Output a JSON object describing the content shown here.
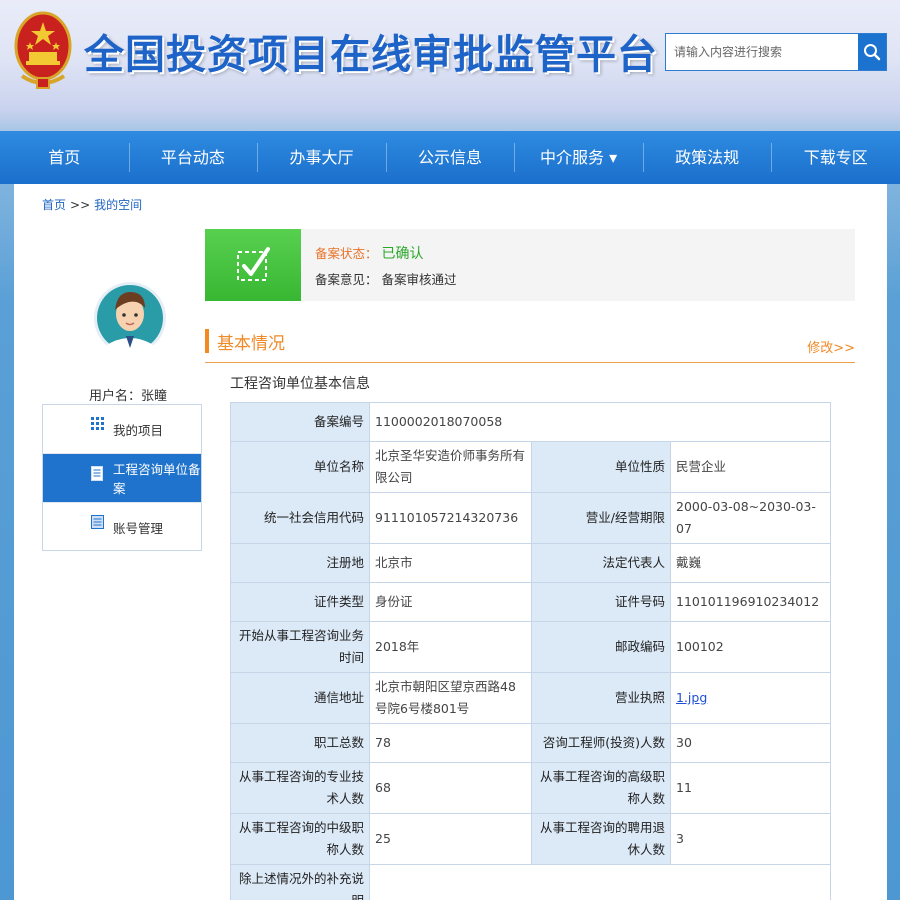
{
  "header": {
    "title": "全国投资项目在线审批监管平台",
    "search_placeholder": "请输入内容进行搜索"
  },
  "nav": {
    "items": [
      "首页",
      "平台动态",
      "办事大厅",
      "公示信息",
      "中介服务 ▾",
      "政策法规",
      "下载专区"
    ]
  },
  "breadcrumb": {
    "home": "首页",
    "sep": ">>",
    "current": "我的空间"
  },
  "user": {
    "label": "用户名：张瞳"
  },
  "side_menu": {
    "items": [
      {
        "label": "我的项目",
        "icon": "grid-icon"
      },
      {
        "label": "工程咨询单位备案",
        "icon": "document-icon",
        "active": true
      },
      {
        "label": "账号管理",
        "icon": "account-icon"
      }
    ]
  },
  "status": {
    "state_label": "备案状态：",
    "state_value": "已确认",
    "opinion_label": "备案意见：",
    "opinion_value": "备案审核通过"
  },
  "section": {
    "title": "基本情况",
    "edit": "修改>>"
  },
  "subtitle": "工程咨询单位基本信息",
  "table": {
    "filing_no_label": "备案编号",
    "filing_no": "1100002018070058",
    "unit_name_label": "单位名称",
    "unit_name": "北京圣华安造价师事务所有限公司",
    "nature_label": "单位性质",
    "nature": "民营企业",
    "credit_code_label": "统一社会信用代码",
    "credit_code": "911101057214320736",
    "period_label": "营业/经营期限",
    "period": "2000-03-08~2030-03-07",
    "reg_place_label": "注册地",
    "reg_place": "北京市",
    "legal_rep_label": "法定代表人",
    "legal_rep": "戴巍",
    "id_type_label": "证件类型",
    "id_type": "身份证",
    "id_no_label": "证件号码",
    "id_no": "110101196910234012",
    "start_year_label": "开始从事工程咨询业务时间",
    "start_year": "2018年",
    "postcode_label": "邮政编码",
    "postcode": "100102",
    "address_label": "通信地址",
    "address": "北京市朝阳区望京西路48号院6号楼801号",
    "license_label": "营业执照",
    "license": "1.jpg",
    "staff_label": "职工总数",
    "staff": "78",
    "engineers_label": "咨询工程师(投资)人数",
    "engineers": "30",
    "tech_label": "从事工程咨询的专业技术人数",
    "tech": "68",
    "senior_label": "从事工程咨询的高级职称人数",
    "senior": "11",
    "mid_label": "从事工程咨询的中级职称人数",
    "mid": "25",
    "retired_label": "从事工程咨询的聘用退休人数",
    "retired": "3",
    "extra_label": "除上述情况外的补充说明",
    "extra": ""
  }
}
